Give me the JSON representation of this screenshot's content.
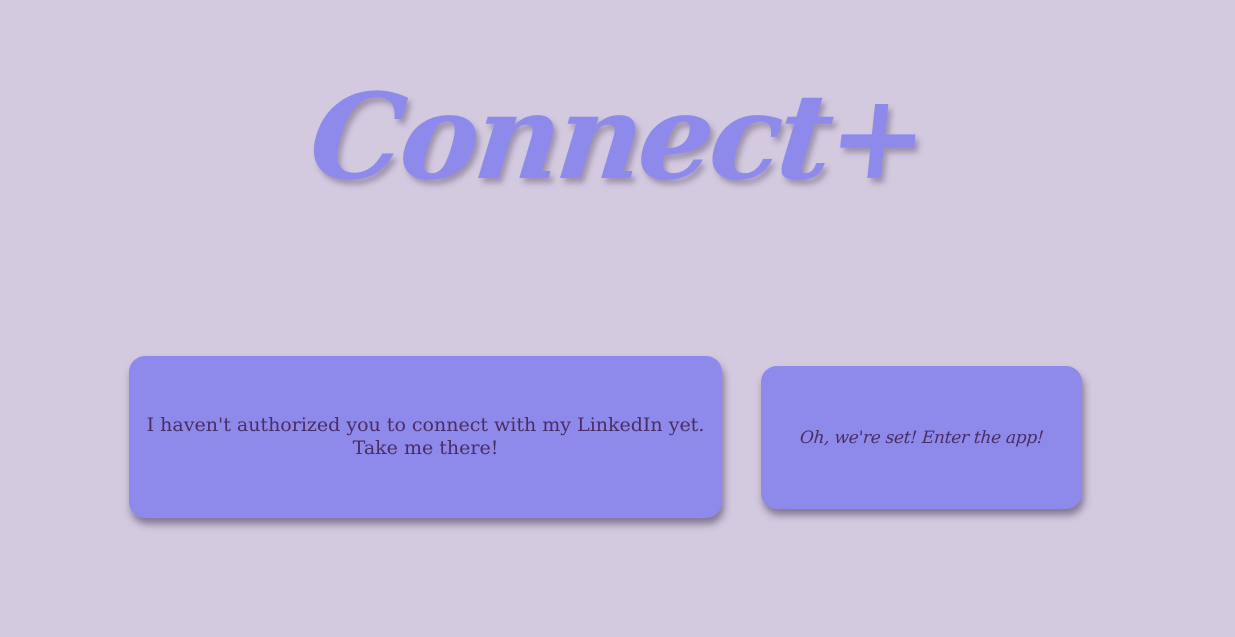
{
  "app": {
    "logo_text": "Connect+"
  },
  "actions": {
    "linkedin": {
      "line1": "I haven't authorized you to connect with my LinkedIn yet.",
      "line2": "Take me there!"
    },
    "enter_app": {
      "label": "Oh, we're set! Enter the app!"
    }
  },
  "colors": {
    "background": "#d4cae0",
    "accent": "#8d8aeb",
    "text": "#4a2d63"
  }
}
